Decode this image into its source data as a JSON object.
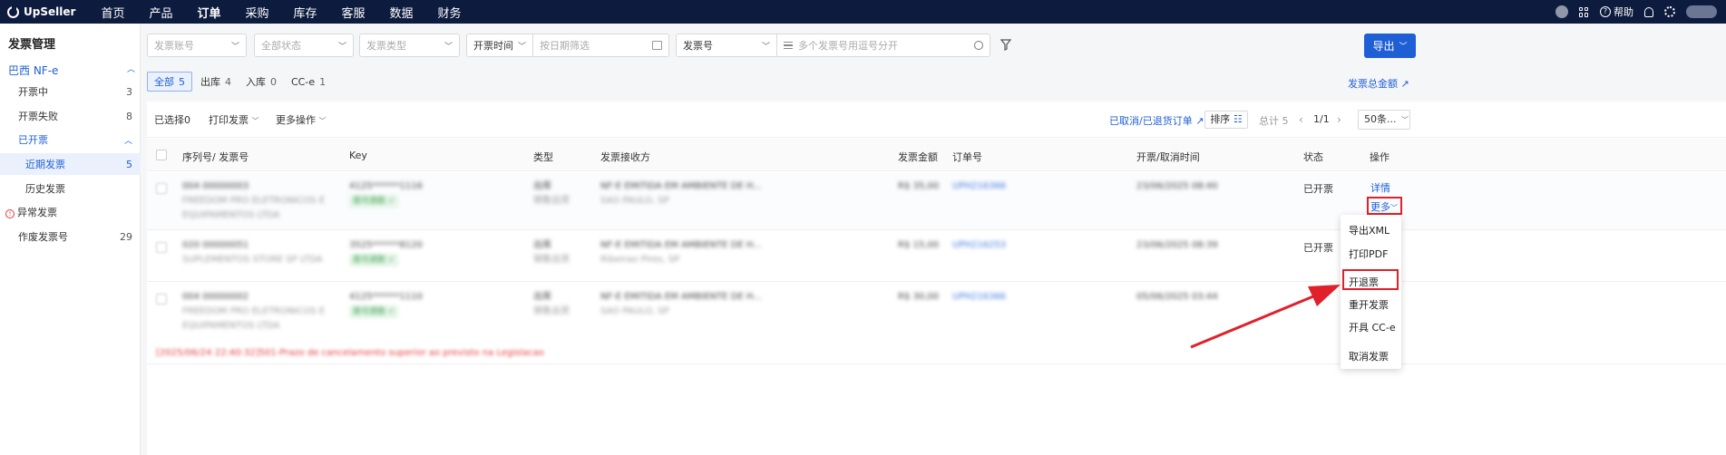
{
  "app": {
    "logo": "UpSeller"
  },
  "nav": {
    "items": [
      "首页",
      "产品",
      "订单",
      "采购",
      "库存",
      "客服",
      "数据",
      "财务"
    ],
    "active": "订单"
  },
  "top_right": {
    "help": "帮助"
  },
  "sidebar": {
    "title": "发票管理",
    "group": "巴西 NF-e",
    "items": [
      {
        "label": "开票中",
        "count": "3"
      },
      {
        "label": "开票失败",
        "count": "8"
      },
      {
        "label": "已开票",
        "count": ""
      },
      {
        "label": "近期发票",
        "count": "5"
      },
      {
        "label": "历史发票",
        "count": ""
      },
      {
        "label": "异常发票",
        "count": ""
      },
      {
        "label": "作废发票号",
        "count": "29"
      }
    ]
  },
  "filters": {
    "account": "发票账号",
    "status": "全部状态",
    "type": "发票类型",
    "time_field": "开票时间",
    "date_placeholder": "按日期筛选",
    "number_field": "发票号",
    "number_placeholder": "多个发票号用逗号分开"
  },
  "export_button": "导出",
  "tabs": [
    {
      "label": "全部",
      "count": "5"
    },
    {
      "label": "出库",
      "count": "4"
    },
    {
      "label": "入库",
      "count": "0"
    },
    {
      "label": "CC-e",
      "count": "1"
    }
  ],
  "total_amount_link": "发票总金额",
  "toolbar": {
    "selected_label": "已选择",
    "selected_count": "0",
    "print": "打印发票",
    "more_ops": "更多操作",
    "cancelled_link": "已取消/已退货订单",
    "sort": "排序",
    "total": "总计 5",
    "page": "1/1",
    "per_page": "50条..."
  },
  "columns": [
    "序列号/ 发票号",
    "Key",
    "类型",
    "发票接收方",
    "发票金额",
    "订单号",
    "开票/取消时间",
    "状态",
    "操作"
  ],
  "rows": [
    {
      "serial": "004 00000003",
      "name1": "FREEDOM PRO ELETRONICOS E",
      "name2": "EQUIPAMENTOS LTDA",
      "key": "4125******1116",
      "badge": "是可退款 ✓",
      "type": "出库",
      "type_sub": "销售出货",
      "recipient": "NF-E EMITIDA EM AMBIENTE DE H...",
      "recipient_sub": "SAO PAULO, SP",
      "amount": "R$ 35,00",
      "order": "UPH216366",
      "time": "23/06/2025 08:40",
      "status": "已开票",
      "action": "详情",
      "more": "更多"
    },
    {
      "serial": "020 00000051",
      "name1": "SUPLEMENTOS STORE SP LTDA",
      "name2": "",
      "key": "3525******8120",
      "badge": "是可退款 ✓",
      "type": "出库",
      "type_sub": "销售出货",
      "recipient": "NF-E EMITIDA EM AMBIENTE DE H...",
      "recipient_sub": "Ribeirao Pires, SP",
      "amount": "R$ 15,00",
      "order": "UPH216253",
      "time": "23/06/2025 08:39",
      "status": "已开票",
      "action": "",
      "more": ""
    },
    {
      "serial": "004 00000002",
      "name1": "FREEDOM PRO ELETRONICOS E",
      "name2": "EQUIPAMENTOS LTDA",
      "key": "4125******1110",
      "badge": "是可退款 ✓",
      "type": "出库",
      "type_sub": "销售出货",
      "recipient": "NF-E EMITIDA EM AMBIENTE DE H...",
      "recipient_sub": "SAO PAULO, SP",
      "amount": "R$ 30,00",
      "order": "UPH216366",
      "time": "05/06/2025 03:44",
      "status": "",
      "action": "",
      "more": ""
    }
  ],
  "row_error": "[2025/06/24 22:40:32]501-Prazo de cancelamento superior ao previsto na Legislacao",
  "dropdown": [
    "导出XML",
    "打印PDF",
    "开退票",
    "重开发票",
    "开具 CC-e",
    "取消发票"
  ],
  "colors": {
    "brand": "#1f5fd6",
    "topbar": "#0d1b3e",
    "highlight": "#e0202a"
  }
}
